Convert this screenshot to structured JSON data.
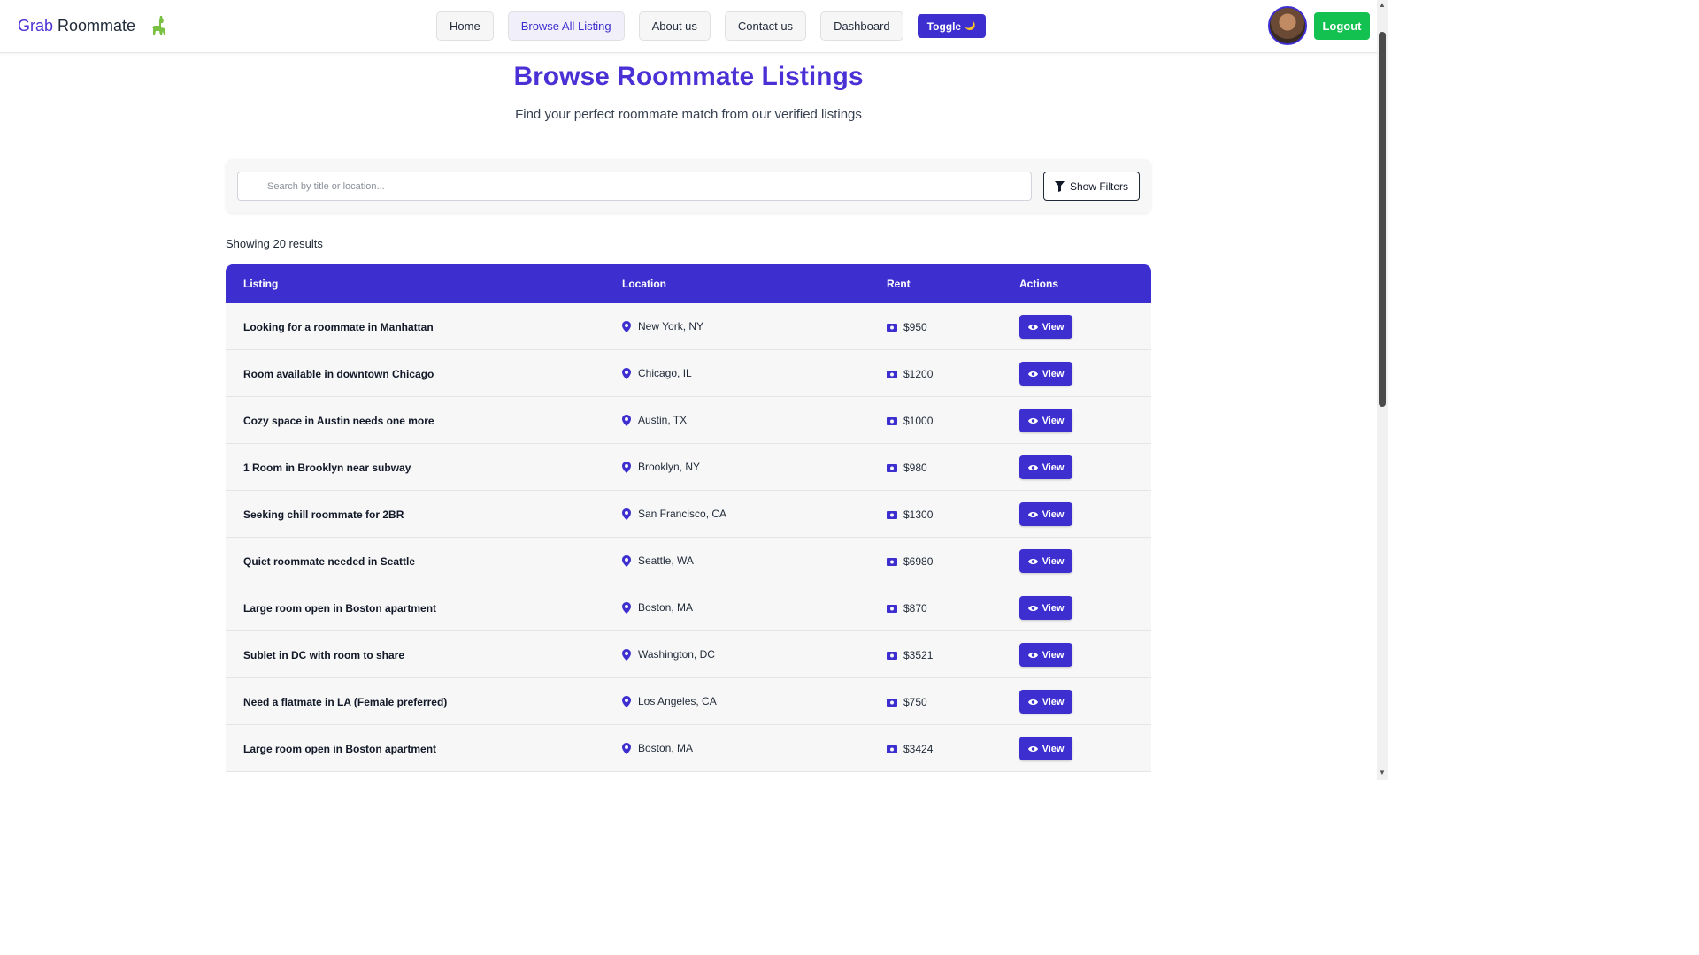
{
  "brand": {
    "part1": "Grab",
    "part2": "Roommate",
    "logo_icon": "llama-icon"
  },
  "nav": [
    {
      "label": "Home",
      "active": false
    },
    {
      "label": "Browse All Listing",
      "active": true
    },
    {
      "label": "About us",
      "active": false
    },
    {
      "label": "Contact us",
      "active": false
    },
    {
      "label": "Dashboard",
      "active": false
    }
  ],
  "toggle": {
    "label": "Toggle",
    "icon": "🌙"
  },
  "logout_label": "Logout",
  "hero": {
    "title": "Browse Roommate Listings",
    "subtitle": "Find your perfect roommate match from our verified listings"
  },
  "search": {
    "placeholder": "Search by title or location...",
    "filter_label": "Show Filters"
  },
  "results_label": "Showing 20 results",
  "table": {
    "headers": {
      "listing": "Listing",
      "location": "Location",
      "rent": "Rent",
      "actions": "Actions"
    },
    "view_label": "View",
    "rows": [
      {
        "title": "Looking for a roommate in Manhattan",
        "location": "New York, NY",
        "rent": "$950"
      },
      {
        "title": "Room available in downtown Chicago",
        "location": "Chicago, IL",
        "rent": "$1200"
      },
      {
        "title": "Cozy space in Austin needs one more",
        "location": "Austin, TX",
        "rent": "$1000"
      },
      {
        "title": "1 Room in Brooklyn near subway",
        "location": "Brooklyn, NY",
        "rent": "$980"
      },
      {
        "title": "Seeking chill roommate for 2BR",
        "location": "San Francisco, CA",
        "rent": "$1300"
      },
      {
        "title": "Quiet roommate needed in Seattle",
        "location": "Seattle, WA",
        "rent": "$6980"
      },
      {
        "title": "Large room open in Boston apartment",
        "location": "Boston, MA",
        "rent": "$870"
      },
      {
        "title": "Sublet in DC with room to share",
        "location": "Washington, DC",
        "rent": "$3521"
      },
      {
        "title": "Need a flatmate in LA (Female preferred)",
        "location": "Los Angeles, CA",
        "rent": "$750"
      },
      {
        "title": "Large room open in Boston apartment",
        "location": "Boston, MA",
        "rent": "$3424"
      }
    ]
  },
  "colors": {
    "primary": "#3d2ecf",
    "logout": "#12c150"
  }
}
